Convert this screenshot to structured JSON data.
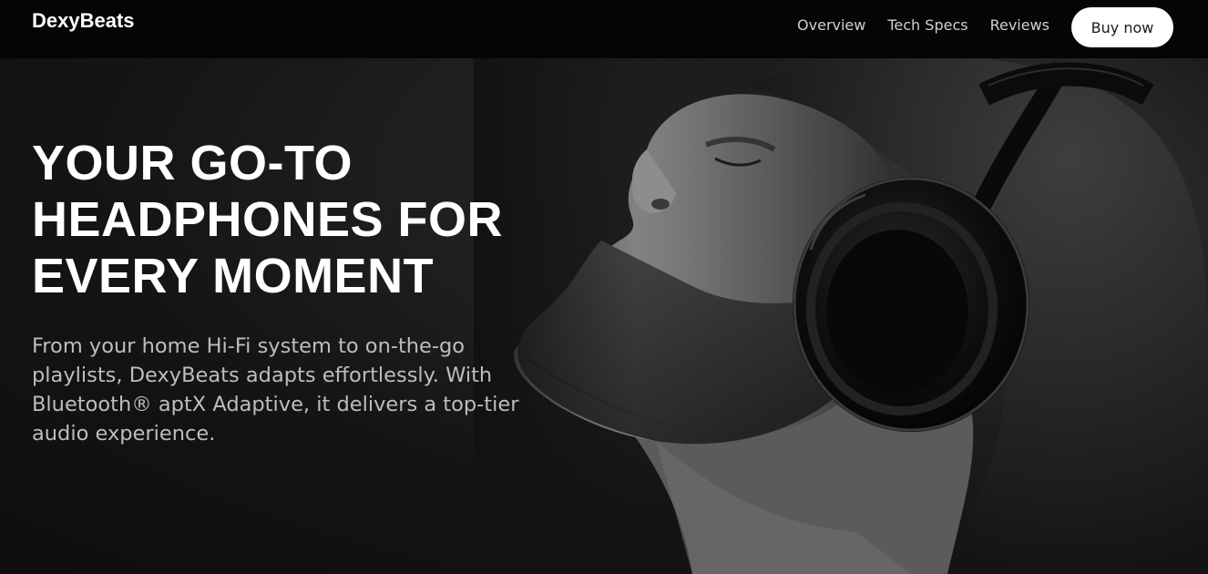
{
  "brand": {
    "name": "DexyBeats"
  },
  "nav": {
    "links": [
      "Overview",
      "Tech Specs",
      "Reviews"
    ],
    "cta": "Buy now"
  },
  "hero": {
    "title": "YOUR GO-TO HEADPHONES FOR EVERY MOMENT",
    "description": "From your home Hi-Fi system to on-the-go playlists, DexyBeats adapts effortlessly. With Bluetooth® aptX Adaptive, it delivers a top-tier audio experience.",
    "image_icon": "man-with-headphones-photo"
  },
  "colors": {
    "background": "#111111",
    "nav_background": "#050505",
    "title": "#ffffff",
    "description": "#bdbdbd",
    "button_bg": "#ffffff",
    "button_text": "#1a1a1a"
  }
}
